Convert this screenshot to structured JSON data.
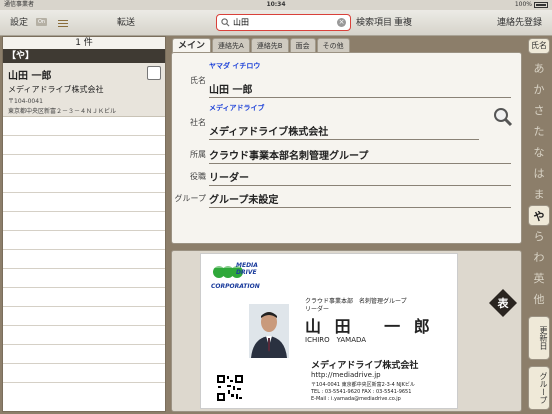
{
  "status": {
    "carrier": "通信事業者",
    "time": "10:34",
    "battery": "100%"
  },
  "toolbar": {
    "settings": "設定",
    "badge": "On",
    "transfer": "転送",
    "search_value": "山田",
    "search_item": "検索項目",
    "duplicate": "重複",
    "company_search": "連絡先登録"
  },
  "list": {
    "count": "1 件",
    "section": "【や】",
    "items": [
      {
        "name": "山田 一郎",
        "company": "メディアドライブ株式会社",
        "zip": "〒104-0041",
        "address": "東京都中央区新富２－３－４ＮＪＫビル"
      }
    ]
  },
  "tabs": [
    "メイン",
    "連絡先A",
    "連絡先B",
    "面会",
    "その他"
  ],
  "detail": {
    "name_label": "氏名",
    "name_kana": "ヤマダ イチロウ",
    "name": "山田 一郎",
    "company_label": "社名",
    "company_kana": "メディアドライブ",
    "company": "メディアドライブ株式会社",
    "dept_label": "所属",
    "dept": "クラウド事業本部名刺管理グループ",
    "role_label": "役職",
    "role": "リーダー",
    "group_label": "グループ",
    "group": "グループ未設定"
  },
  "card": {
    "logo_line1": "MEDIA",
    "logo_line2": "DRIVE",
    "logo_line3": "CORPORATION",
    "dept": "クラウド事業本部　名刺管理グループ",
    "role": "リーダー",
    "name": "山 田　 一 郎",
    "roman": "ICHIRO　YAMADA",
    "company": "メディアドライブ株式会社",
    "url": "http://mediadrive.jp",
    "address": "〒104-0041 東京都中央区新富2-3-4 NJKビル",
    "tel": "TEL : 03-5541-9620  FAX : 03-5541-9651",
    "email": "E-Mail : i.yamada@mediadrive.co.jp",
    "flip_label": "表"
  },
  "index": {
    "name_button": "氏名",
    "letters": [
      "あ",
      "か",
      "さ",
      "た",
      "な",
      "は",
      "ま",
      "や",
      "ら",
      "わ",
      "英",
      "他"
    ],
    "selected": "や",
    "update_button": "更新日",
    "group_button": "グループ"
  }
}
